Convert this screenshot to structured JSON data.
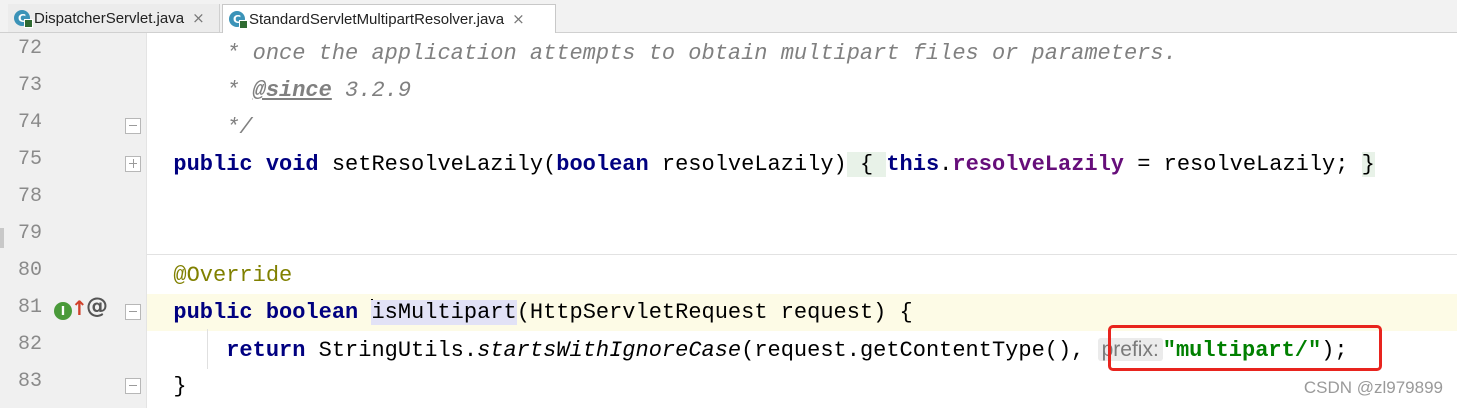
{
  "tabs": [
    {
      "label": "DispatcherServlet.java",
      "icon": "java-class-icon",
      "close": "×"
    },
    {
      "label": "StandardServletMultipartResolver.java",
      "icon": "java-class-icon",
      "close": "×"
    }
  ],
  "file_icon_letter": "C",
  "line_numbers": [
    "72",
    "73",
    "74",
    "75",
    "78",
    "79",
    "80",
    "81",
    "82",
    "83"
  ],
  "code": {
    "l72": "* once the application attempts to obtain multipart files or parameters.",
    "l73_star": "* ",
    "l73_tag": "@since",
    "l73_ver": " 3.2.9",
    "l74": "*/",
    "l75_kw1": "public void ",
    "l75_name": "setResolveLazily(",
    "l75_kw2": "boolean",
    "l75_param": " resolveLazily)",
    "l75_open": " { ",
    "l75_this": "this",
    "l75_dot": ".",
    "l75_field": "resolveLazily",
    "l75_rest": " = resolveLazily; ",
    "l75_close": "}",
    "l80": "@Override",
    "l81_kw": "public boolean ",
    "l81_name": "isMultipart",
    "l81_rest": "(HttpServletRequest request) {",
    "l82_kw": "return ",
    "l82_cls": "StringUtils.",
    "l82_method": "startsWithIgnoreCase",
    "l82_args": "(request.getContentType(), ",
    "l82_hint": "prefix:",
    "l82_str": "\"multipart/\"",
    "l82_end": ");",
    "l83": "}"
  },
  "gutter_icons": {
    "impl": "I",
    "arrow": "↑",
    "at": "@"
  },
  "watermark": "CSDN @zl979899"
}
